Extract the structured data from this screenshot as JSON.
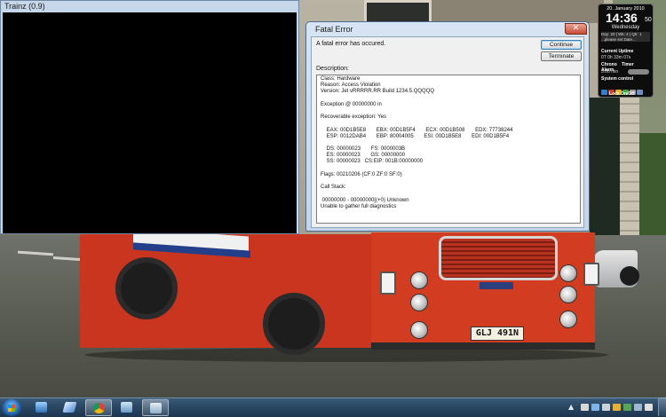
{
  "trainz_window": {
    "title": "Trainz  (0.9)"
  },
  "dialog": {
    "title": "Fatal Error",
    "close_glyph": "✕",
    "message": "A fatal error has occured.",
    "continue_label": "Continue",
    "terminate_label": "Terminate",
    "description_label": "Description:",
    "lines": [
      "Class: Hardware",
      "Reason: Access Violation",
      "Version: Jet vRRRRR.RR Build 1234.5.QQQQQ",
      "",
      "Exception @ 00000000 in",
      "",
      "Recoverable exception: Yes",
      "",
      "    EAX: 00D1B5E8       EBX: 00D1B5F4       ECX: 00D1B508       EDX: 77738244",
      "    ESP: 0012DAB4       EBP: 80004005       ESI: 00D1B5E8       EDI: 00D1B5F4",
      "",
      "    DS: 00000023       FS: 0000003B",
      "    ES: 00000023       GS: 00000000",
      "    SS: 00000023   CS:EIP: 001B:00000000",
      "",
      "Flags: 00210206 (CF:0 ZF:0 SF:0)",
      "",
      "Call Stack:",
      "",
      " 00000000 - 00000000[(+0) Unknown",
      "Unable to gather full diagnostics"
    ]
  },
  "gadget": {
    "date": "20. January 2010",
    "time": "14:36",
    "seconds": "50",
    "weekday": "Wednesday",
    "info_line1": "Day: 20 | Wk: 4 |  Qtr: 1",
    "info_line2": "...please set Date...",
    "uptime_label": "Current Uptime",
    "uptime_value": "0T 0h 33m 07s",
    "tab_chrono": "Chrono",
    "tab_timer": "Timer",
    "tab_alarm": "Alarm",
    "alarm_value": "3:00 min",
    "system_control": "System control",
    "lock_label": "Lock On/Off"
  },
  "bus": {
    "plate": "GLJ 491N"
  },
  "colors": {
    "taskbar": "#2a4762",
    "dialog_frame": "#c3d5ea",
    "bus_red": "#c9351e"
  }
}
